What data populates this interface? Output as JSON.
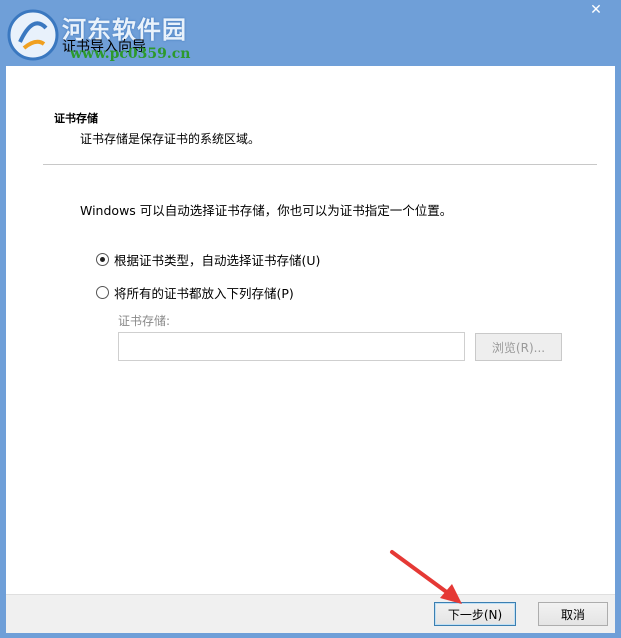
{
  "watermark": {
    "site_name": "河东软件园",
    "site_url": "www.pc0359.cn"
  },
  "window": {
    "title": "证书导入向导",
    "close_glyph": "✕"
  },
  "page": {
    "section_title": "证书存储",
    "section_desc": "证书存储是保存证书的系统区域。",
    "intro": "Windows 可以自动选择证书存储，你也可以为证书指定一个位置。",
    "options": [
      {
        "label": "根据证书类型，自动选择证书存储(U)",
        "checked": true
      },
      {
        "label": "将所有的证书都放入下列存储(P)",
        "checked": false
      }
    ],
    "store_label": "证书存储:",
    "store_value": "",
    "browse_label": "浏览(R)..."
  },
  "footer": {
    "next_label": "下一步(N)",
    "cancel_label": "取消"
  },
  "annotation": {
    "arrow_color": "#e53935"
  }
}
